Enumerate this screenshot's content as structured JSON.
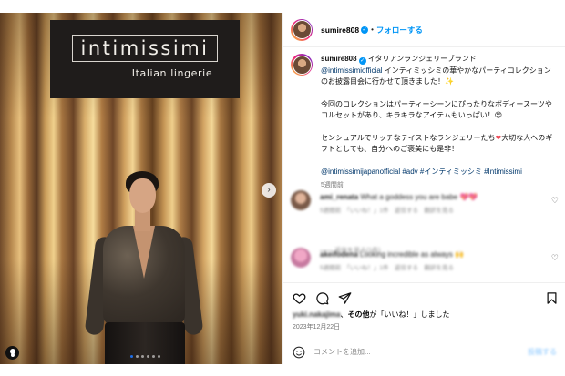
{
  "post": {
    "username": "sumire808",
    "follow_label": "フォローする",
    "separator": "•",
    "more_label": "•••"
  },
  "media": {
    "brand": "intimissimi",
    "brand_sub": "Italian lingerie",
    "next_arrow": "›",
    "carousel_index": 1,
    "carousel_total": 6
  },
  "caption": {
    "username": "sumire808",
    "line1_rest": " イタリアンランジェリーブランド",
    "mention": "@intimissimiofficial",
    "line1_tail": " インティミッシミの華やかなパーティコレクションのお披露目会に行かせて頂きました！✨",
    "para2": "今回のコレクションはパーティーシーンにぴったりなボディースーツやコルセットがあり、キラキラなアイテムもいっぱい！😍",
    "para3_a": "センシュアルでリッチなテイストなランジェリーたち",
    "para3_heart": "❤",
    "para3_b": "大切な人へのギフトとしても、自分へのご褒美にも是非！",
    "tags": "@intimissimijapanofficial #adv #インティミッシミ #Intimissimi",
    "time": "5週間前"
  },
  "comments": [
    {
      "user": "ami_renata",
      "text": "What a goddess you are babe 💖💖",
      "meta": "5週間前　「いいね！」1件　返信する　翻訳を見る"
    },
    {
      "user": "akeifodena",
      "text": "Looking incredible as always 🙌",
      "meta": "5週間前　「いいね！」1件　返信する　翻訳を見る"
    }
  ],
  "view_replies": "―― 返信を見る(1件)",
  "likes": {
    "user_blurred": "yuki.nakajima",
    "and_others": "その他",
    "suffix": "が「いいね！」しました"
  },
  "date": "2023年12月22日",
  "comment_input": {
    "placeholder": "コメントを追加...",
    "post_label": "投稿する"
  },
  "colors": {
    "accent": "#0095f6",
    "link": "#00376b",
    "heart": "#ed4956"
  }
}
